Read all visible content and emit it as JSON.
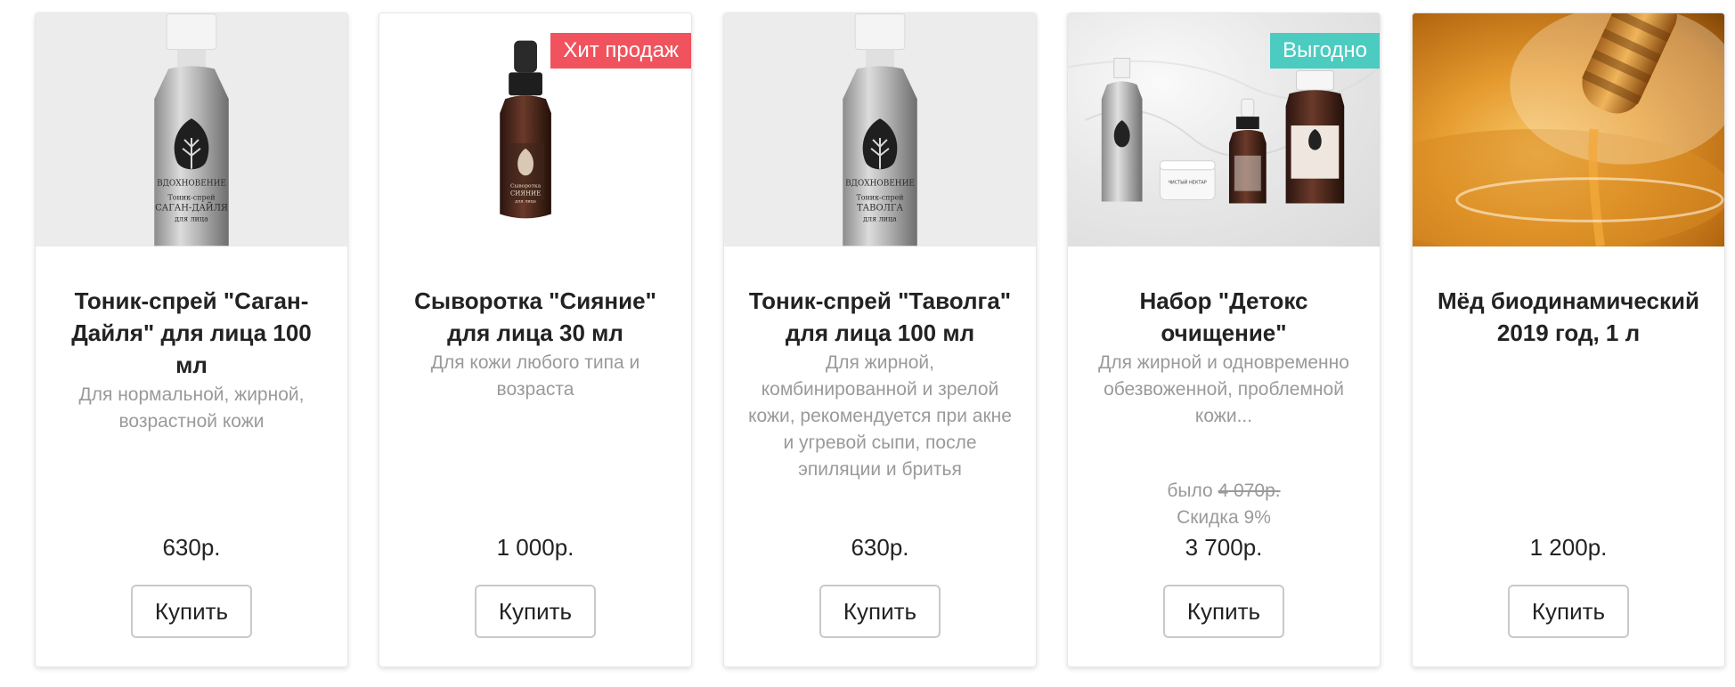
{
  "products": [
    {
      "title": "Тоник-спрей \"Саган-Дайля\" для лица 100 мл",
      "description": "Для нормальной, жирной, возрастной кожи",
      "price": "630р.",
      "button": "Купить",
      "image_icon": "aluminum-spray-bottle-icon",
      "bottle_label": [
        "ВДОХНОВЕНИЕ",
        "Тоник-спрей",
        "САГАН-ДАЙЛЯ",
        "для лица"
      ]
    },
    {
      "title": "Сыворотка \"Сияние\" для лица 30 мл",
      "description": "Для кожи любого типа и возраста",
      "price": "1 000р.",
      "button": "Купить",
      "badge": "Хит продаж",
      "badge_color": "#f0535d",
      "image_icon": "amber-dropper-bottle-icon",
      "bottle_label": [
        "Сыворотка",
        "СИЯНИЕ",
        "для лица"
      ]
    },
    {
      "title": "Тоник-спрей \"Таволга\" для лица 100 мл",
      "description": "Для жирной, комбинированной и зрелой кожи, рекомендуется при акне и угревой сыпи, после эпиляции и бритья",
      "price": "630р.",
      "button": "Купить",
      "image_icon": "aluminum-spray-bottle-icon",
      "bottle_label": [
        "ВДОХНОВЕНИЕ",
        "Тоник-спрей",
        "ТАВОЛГА",
        "для лица"
      ]
    },
    {
      "title": "Набор \"Детокс очищение\"",
      "description": "Для жирной и одновременно обезвоженной, проблемной кожи...",
      "old_price_label": "было",
      "old_price": "4 070р.",
      "discount": "Скидка 9%",
      "price": "3 700р.",
      "button": "Купить",
      "badge": "Выгодно",
      "badge_color": "#4ccbc1",
      "image_icon": "cosmetics-set-icon",
      "jar_label": "ЧИСТЫЙ НЕКТАР"
    },
    {
      "title": "Мёд биодинамический 2019 год, 1 л",
      "description": "",
      "price": "1 200р.",
      "button": "Купить",
      "image_icon": "honey-dipper-icon"
    }
  ],
  "colors": {
    "accent_red": "#f0535d",
    "accent_teal": "#4ccbc1",
    "text": "#222222",
    "muted": "#9a9a9a"
  }
}
